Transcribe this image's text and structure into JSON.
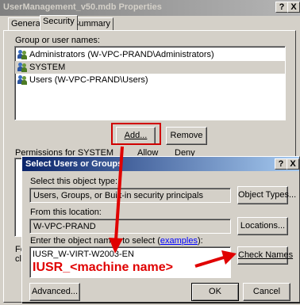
{
  "properties": {
    "title": "UserManagement_v50.mdb Properties",
    "title_buttons": [
      "?",
      "X"
    ],
    "tabs": [
      "General",
      "Security",
      "Summary"
    ],
    "group_label": "Group or user names:",
    "principals": [
      "Administrators (W-VPC-PRAND\\Administrators)",
      "SYSTEM",
      "Users (W-VPC-PRAND\\Users)"
    ],
    "add_button": "Add...",
    "remove_button": "Remove",
    "permissions_label": "Permissions for SYSTEM",
    "allow_header": "Allow",
    "deny_header": "Deny",
    "cut_text_1": "Fo",
    "cut_text_2": "cli"
  },
  "dialog": {
    "title": "Select Users or Groups",
    "title_buttons": [
      "?",
      "X"
    ],
    "object_type_label": "Select this object type:",
    "object_type_value": "Users, Groups, or Built-in security principals",
    "object_types_button": "Object Types...",
    "location_label": "From this location:",
    "location_value": "W-VPC-PRAND",
    "locations_button": "Locations...",
    "names_label_prefix": "Enter the object names to select (",
    "names_label_link": "examples",
    "names_label_suffix": "):",
    "names_value": "IUSR_W-VIRT-W2003-EN",
    "check_names_button": "Check Names",
    "advanced_button": "Advanced...",
    "ok_button": "OK",
    "cancel_button": "Cancel"
  },
  "annotation": {
    "text": "IUSR_<machine name>",
    "color": "#e00000"
  }
}
